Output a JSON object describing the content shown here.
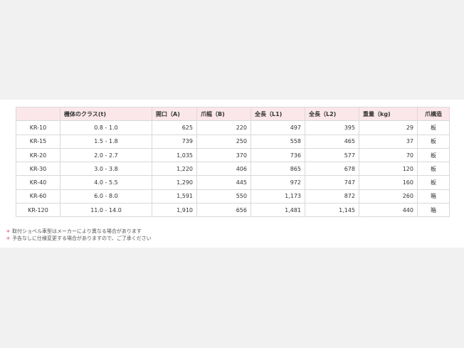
{
  "table": {
    "headers": [
      "",
      "機体のクラス(t)",
      "開口（A)",
      "爪幅（B)",
      "全長（L1)",
      "全長（L2)",
      "重量（kg)",
      "爪構造"
    ],
    "rows": [
      [
        "KR-10",
        "0.8 - 1.0",
        "625",
        "220",
        "497",
        "395",
        "29",
        "板"
      ],
      [
        "KR-15",
        "1.5 - 1.8",
        "739",
        "250",
        "558",
        "465",
        "37",
        "板"
      ],
      [
        "KR-20",
        "2.0 - 2.7",
        "1,035",
        "370",
        "736",
        "577",
        "70",
        "板"
      ],
      [
        "KR-30",
        "3.0 - 3.8",
        "1,220",
        "406",
        "865",
        "678",
        "120",
        "板"
      ],
      [
        "KR-40",
        "4.0 - 5.5",
        "1,290",
        "445",
        "972",
        "747",
        "160",
        "板"
      ],
      [
        "KR-60",
        "6.0 - 8.0",
        "1,591",
        "550",
        "1,173",
        "872",
        "260",
        "箱"
      ],
      [
        "KR-120",
        "11.0 - 14.0",
        "1,910",
        "656",
        "1,481",
        "1,145",
        "440",
        "箱"
      ]
    ]
  },
  "notes": {
    "mark": "＊",
    "items": [
      "取付ショベル車型はメーカーにより異なる場合があります",
      "予告なしに仕様変更する場合がありますので、ご了承ください"
    ]
  }
}
